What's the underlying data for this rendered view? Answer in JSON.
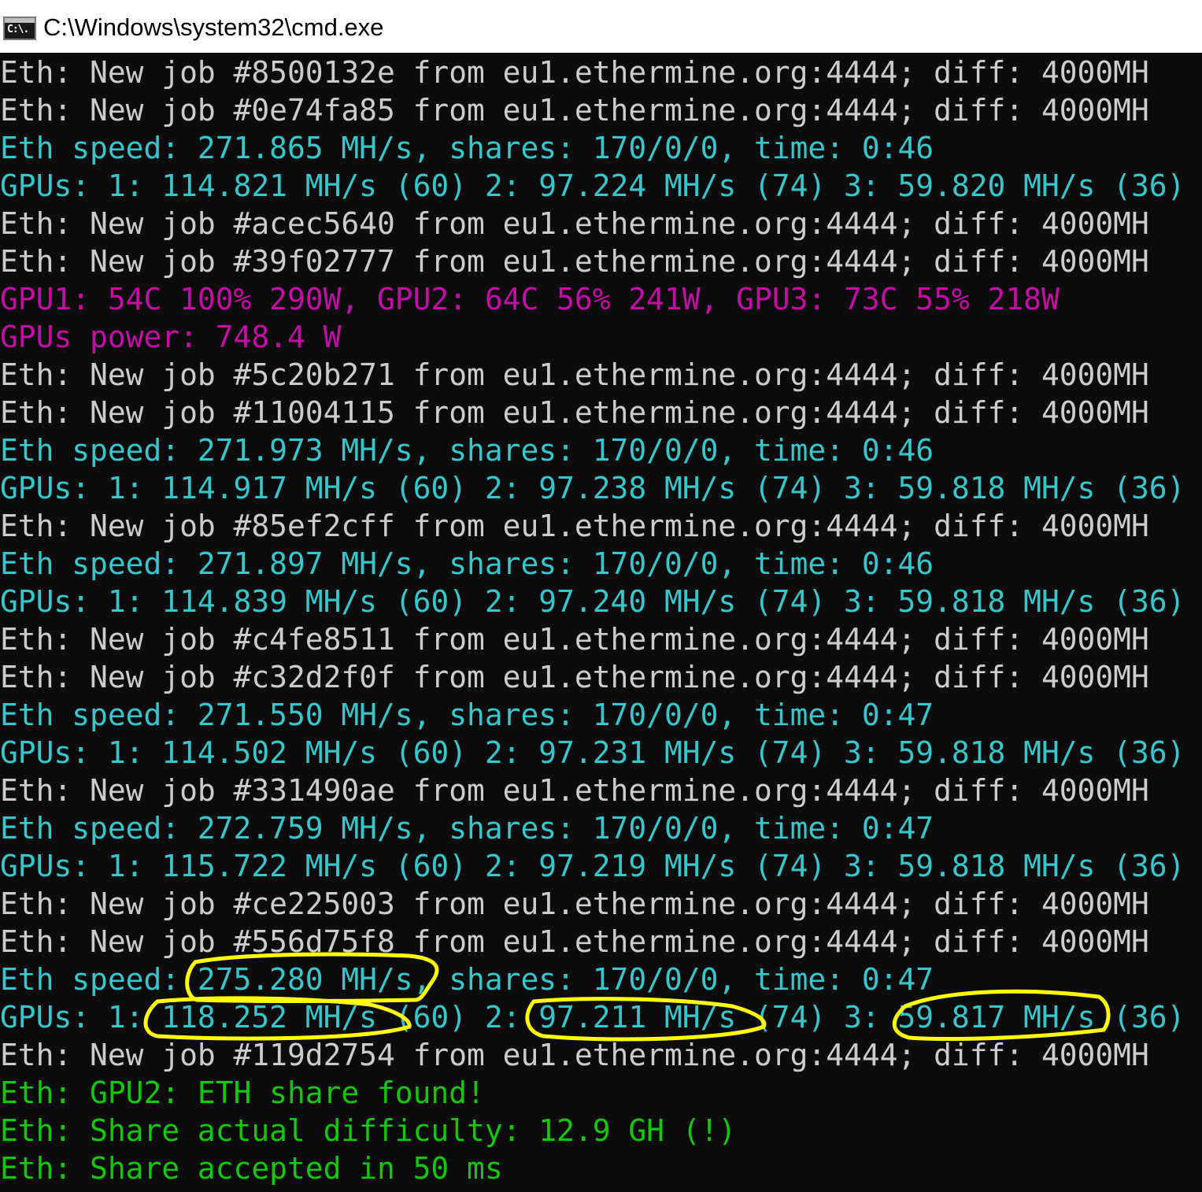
{
  "window": {
    "title": "C:\\Windows\\system32\\cmd.exe",
    "icon_name": "cmd-console-icon",
    "icon_text": "C:\\."
  },
  "colors": {
    "job": "#cccccc",
    "speed": "#3ac5c8",
    "gpu_stats": "#c30ea4",
    "share": "#16c60c",
    "annotation": "#ffff00"
  },
  "console": {
    "lines": [
      {
        "type": "job",
        "text": "Eth: New job #8500132e from eu1.ethermine.org:4444; diff: 4000MH"
      },
      {
        "type": "job",
        "text": "Eth: New job #0e74fa85 from eu1.ethermine.org:4444; diff: 4000MH"
      },
      {
        "type": "speed",
        "text": "Eth speed: 271.865 MH/s, shares: 170/0/0, time: 0:46"
      },
      {
        "type": "speed",
        "text": "GPUs: 1: 114.821 MH/s (60) 2: 97.224 MH/s (74) 3: 59.820 MH/s (36)"
      },
      {
        "type": "job",
        "text": "Eth: New job #acec5640 from eu1.ethermine.org:4444; diff: 4000MH"
      },
      {
        "type": "job",
        "text": "Eth: New job #39f02777 from eu1.ethermine.org:4444; diff: 4000MH"
      },
      {
        "type": "gpu_stats",
        "text": "GPU1: 54C 100% 290W, GPU2: 64C 56% 241W, GPU3: 73C 55% 218W"
      },
      {
        "type": "gpu_stats",
        "text": "GPUs power: 748.4 W"
      },
      {
        "type": "job",
        "text": "Eth: New job #5c20b271 from eu1.ethermine.org:4444; diff: 4000MH"
      },
      {
        "type": "job",
        "text": "Eth: New job #11004115 from eu1.ethermine.org:4444; diff: 4000MH"
      },
      {
        "type": "speed",
        "text": "Eth speed: 271.973 MH/s, shares: 170/0/0, time: 0:46"
      },
      {
        "type": "speed",
        "text": "GPUs: 1: 114.917 MH/s (60) 2: 97.238 MH/s (74) 3: 59.818 MH/s (36)"
      },
      {
        "type": "job",
        "text": "Eth: New job #85ef2cff from eu1.ethermine.org:4444; diff: 4000MH"
      },
      {
        "type": "speed",
        "text": "Eth speed: 271.897 MH/s, shares: 170/0/0, time: 0:46"
      },
      {
        "type": "speed",
        "text": "GPUs: 1: 114.839 MH/s (60) 2: 97.240 MH/s (74) 3: 59.818 MH/s (36)"
      },
      {
        "type": "job",
        "text": "Eth: New job #c4fe8511 from eu1.ethermine.org:4444; diff: 4000MH"
      },
      {
        "type": "job",
        "text": "Eth: New job #c32d2f0f from eu1.ethermine.org:4444; diff: 4000MH"
      },
      {
        "type": "speed",
        "text": "Eth speed: 271.550 MH/s, shares: 170/0/0, time: 0:47"
      },
      {
        "type": "speed",
        "text": "GPUs: 1: 114.502 MH/s (60) 2: 97.231 MH/s (74) 3: 59.818 MH/s (36)"
      },
      {
        "type": "job",
        "text": "Eth: New job #331490ae from eu1.ethermine.org:4444; diff: 4000MH"
      },
      {
        "type": "speed",
        "text": "Eth speed: 272.759 MH/s, shares: 170/0/0, time: 0:47"
      },
      {
        "type": "speed",
        "text": "GPUs: 1: 115.722 MH/s (60) 2: 97.219 MH/s (74) 3: 59.818 MH/s (36)"
      },
      {
        "type": "job",
        "text": "Eth: New job #ce225003 from eu1.ethermine.org:4444; diff: 4000MH"
      },
      {
        "type": "job",
        "text": "Eth: New job #556d75f8 from eu1.ethermine.org:4444; diff: 4000MH"
      },
      {
        "type": "speed",
        "text": "Eth speed: 275.280 MH/s, shares: 170/0/0, time: 0:47"
      },
      {
        "type": "speed",
        "text": "GPUs: 1: 118.252 MH/s (60) 2: 97.211 MH/s (74) 3: 59.817 MH/s (36)"
      },
      {
        "type": "job",
        "text": "Eth: New job #119d2754 from eu1.ethermine.org:4444; diff: 4000MH"
      },
      {
        "type": "share",
        "text": "Eth: GPU2: ETH share found!"
      },
      {
        "type": "share",
        "text": "Eth: Share actual difficulty: 12.9 GH (!)"
      },
      {
        "type": "share",
        "text": "Eth: Share accepted in 50 ms"
      }
    ]
  }
}
